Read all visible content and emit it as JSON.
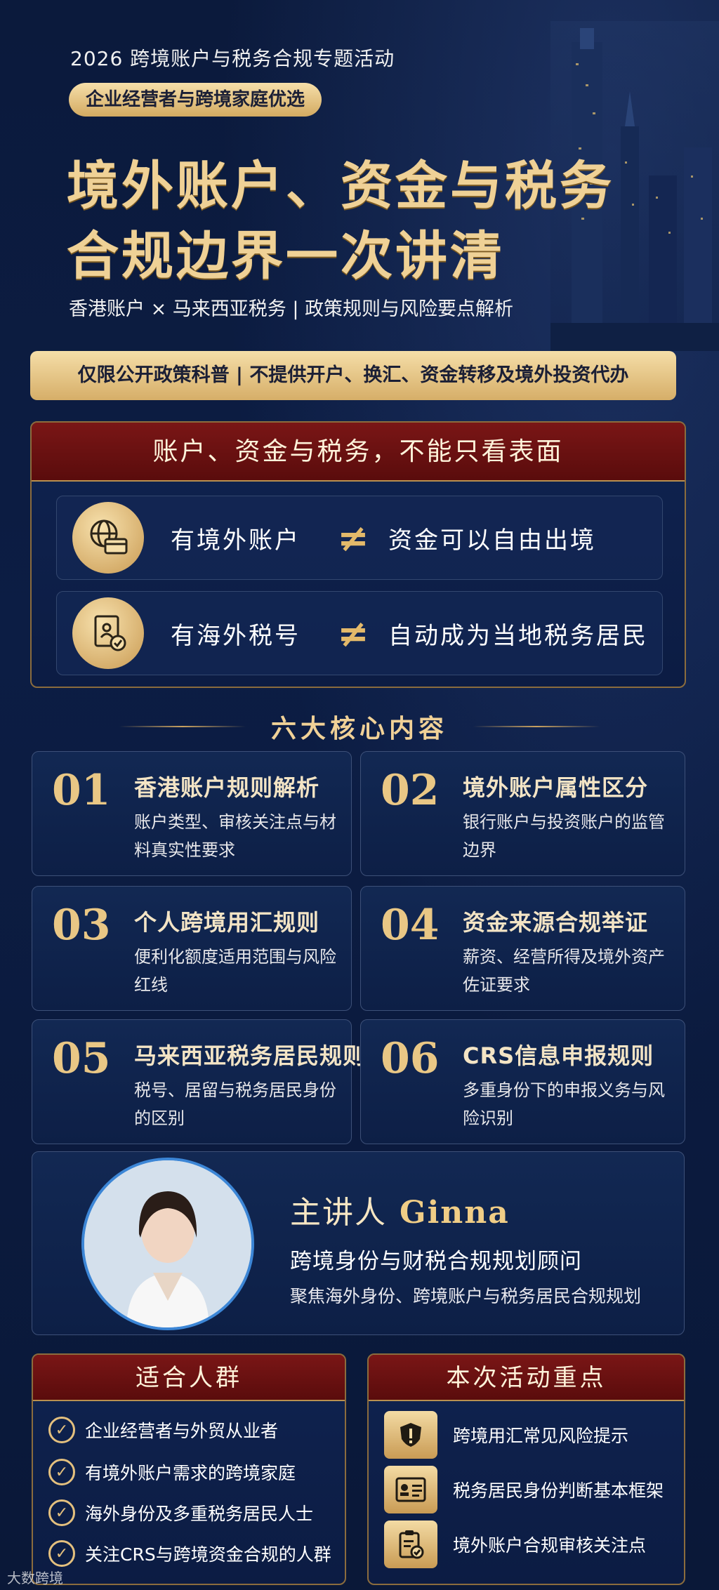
{
  "header": {
    "event_line": "2026 跨境账户与税务合规专题活动",
    "audience_tag": "企业经营者与跨境家庭优选",
    "title_line1": "境外账户、资金与税务",
    "title_line2": "合规边界一次讲清",
    "subtitle": "香港账户 × 马来西亚税务 | 政策规则与风险要点解析",
    "notice": "仅限公开政策科普 | 不提供开户、换汇、资金转移及境外投资代办"
  },
  "myth_box": {
    "heading": "账户、资金与税务，不能只看表面",
    "rows": [
      {
        "left": "有境外账户",
        "symbol": "≠",
        "right": "资金可以自由出境",
        "icon": "globe-card-icon"
      },
      {
        "left": "有海外税号",
        "symbol": "≠",
        "right": "自动成为当地税务居民",
        "icon": "document-check-icon"
      }
    ]
  },
  "core": {
    "heading": "六大核心内容",
    "items": [
      {
        "num": "01",
        "title": "香港账户规则解析",
        "desc": "账户类型、审核关注点与材料真实性要求"
      },
      {
        "num": "02",
        "title": "境外账户属性区分",
        "desc": "银行账户与投资账户的监管边界"
      },
      {
        "num": "03",
        "title": "个人跨境用汇规则",
        "desc": "便利化额度适用范围与风险红线"
      },
      {
        "num": "04",
        "title": "资金来源合规举证",
        "desc": "薪资、经营所得及境外资产佐证要求"
      },
      {
        "num": "05",
        "title": "马来西亚税务居民规则",
        "desc": "税号、居留与税务居民身份的区别"
      },
      {
        "num": "06",
        "title": "CRS信息申报规则",
        "desc": "多重身份下的申报义务与风险识别"
      }
    ]
  },
  "speaker": {
    "label": "主讲人",
    "name": "Ginna",
    "title": "跨境身份与财税合规规划顾问",
    "focus": "聚焦海外身份、跨境账户与税务居民合规规划"
  },
  "audience": {
    "heading": "适合人群",
    "items": [
      "企业经营者与外贸从业者",
      "有境外账户需求的跨境家庭",
      "海外身份及多重税务居民人士",
      "关注CRS与跨境资金合规的人群"
    ]
  },
  "focus": {
    "heading": "本次活动重点",
    "items": [
      {
        "text": "跨境用汇常见风险提示",
        "icon": "warning-shield-icon"
      },
      {
        "text": "税务居民身份判断基本框架",
        "icon": "id-card-icon"
      },
      {
        "text": "境外账户合规审核关注点",
        "icon": "clipboard-check-icon"
      }
    ]
  },
  "watermark": "大数跨境"
}
